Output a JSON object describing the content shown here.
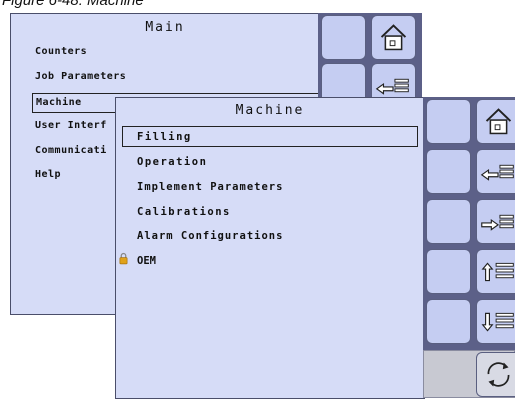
{
  "figure": {
    "caption": "Figure 6-48: Machine"
  },
  "main_menu": {
    "title": "Main",
    "items": [
      {
        "label": "Counters"
      },
      {
        "label": "Job Parameters"
      },
      {
        "label": "Machine"
      },
      {
        "label": "User Interf"
      },
      {
        "label": "Communicati"
      },
      {
        "label": "Help"
      }
    ],
    "selected_index": 2
  },
  "machine_menu": {
    "title": "Machine",
    "items": [
      {
        "label": "Filling"
      },
      {
        "label": "Operation"
      },
      {
        "label": "Implement Parameters"
      },
      {
        "label": "Calibrations"
      },
      {
        "label": "Alarm Configurations"
      },
      {
        "label": "OEM",
        "locked": true
      }
    ],
    "selected_index": 0
  },
  "side_buttons": [
    {
      "icon": "home-icon"
    },
    {
      "icon": "back-list-icon"
    },
    {
      "icon": "enter-list-icon"
    },
    {
      "icon": "scroll-up-icon"
    },
    {
      "icon": "scroll-down-icon"
    },
    {
      "icon": "rotate-icon"
    }
  ],
  "colors": {
    "panel_bg": "#d6dcf7",
    "button_bg": "#c5cdf2",
    "button_strip": "#5c6088",
    "lock": "#e0a21a"
  }
}
